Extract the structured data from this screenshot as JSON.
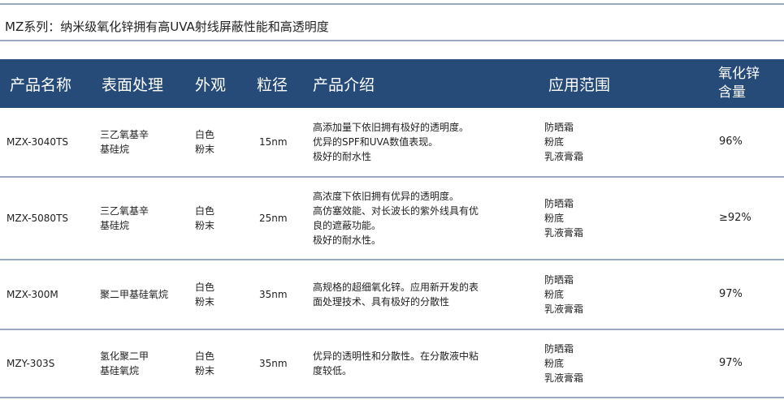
{
  "title": "MZ系列：纳米级氧化锌拥有高UVA射线屏蔽性能和高透明度",
  "headers": {
    "name": "产品名称",
    "surface": "表面处理",
    "appearance": "外观",
    "size": "粒径",
    "intro": "产品介绍",
    "application": "应用范围",
    "zno_line1": "氧化锌",
    "zno_line2": "含量"
  },
  "rows": [
    {
      "name": "MZX-3040TS",
      "surface": [
        "三乙氧基辛",
        "基硅烷"
      ],
      "appearance": [
        "白色",
        "粉末"
      ],
      "size": "15nm",
      "intro": [
        "高添加量下依旧拥有极好的透明度。",
        "优异的SPF和UVA数值表现。",
        "极好的耐水性"
      ],
      "application": [
        "防晒霜",
        "粉底",
        "乳液膏霜"
      ],
      "zno": "96%"
    },
    {
      "name": "MZX-5080TS",
      "surface": [
        "三乙氧基辛",
        "基硅烷"
      ],
      "appearance": [
        "白色",
        "粉末"
      ],
      "size": "25nm",
      "intro": [
        "高浓度下依旧拥有优异的透明度。",
        "高仿塞效能、对长波长的紫外线具有优",
        "良的遮蔽功能。",
        "极好的耐水性。"
      ],
      "application": [
        "防晒霜",
        "粉底",
        "乳液膏霜"
      ],
      "zno": "≥92%"
    },
    {
      "name": "MZX-300M",
      "surface": [
        "聚二甲基硅氧烷"
      ],
      "appearance": [
        "白色",
        "粉末"
      ],
      "size": "35nm",
      "intro": [
        "高规格的超细氧化锌。应用新开发的表",
        "面处理技术、具有极好的分散性"
      ],
      "application": [
        "防晒霜",
        "粉底",
        "乳液膏霜"
      ],
      "zno": "97%"
    },
    {
      "name": "MZY-303S",
      "surface": [
        "氢化聚二甲",
        "基硅氧烷"
      ],
      "appearance": [
        "白色",
        "粉末"
      ],
      "size": "35nm",
      "intro": [
        "优异的透明性和分散性。在分散液中粘",
        "度较低。"
      ],
      "application": [
        "防晒霜",
        "粉底",
        "乳液膏霜"
      ],
      "zno": "97%"
    }
  ]
}
